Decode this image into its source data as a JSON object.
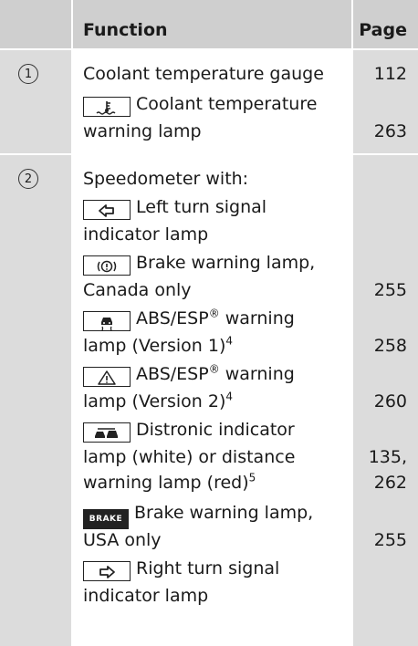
{
  "header": {
    "function_label": "Function",
    "page_label": "Page"
  },
  "rows": [
    {
      "number": "1",
      "items": [
        {
          "text": "Coolant temperature gauge",
          "page": "112"
        },
        {
          "icon": "coolant-temperature-icon",
          "line1": "Coolant temperature",
          "line2": "warning lamp",
          "page": "263"
        }
      ]
    },
    {
      "number": "2",
      "intro": "Speedometer with:",
      "items": [
        {
          "icon": "left-turn-signal-icon",
          "line1": "Left turn signal",
          "line2": "indicator lamp",
          "page": ""
        },
        {
          "icon": "brake-warning-icon",
          "line1": "Brake warning lamp,",
          "line2": "Canada only",
          "page": "255"
        },
        {
          "icon": "abs-esp-icon",
          "line1a": "ABS/ESP",
          "line1b": "®",
          "line1c": " warning",
          "line2a": "lamp (Version 1)",
          "line2b": "4",
          "page": "258"
        },
        {
          "icon": "warning-triangle-icon",
          "line1a": "ABS/ESP",
          "line1b": "®",
          "line1c": " warning",
          "line2a": "lamp (Version 2)",
          "line2b": "4",
          "page": "260"
        },
        {
          "icon": "distronic-icon",
          "line1": "Distronic indicator",
          "line2": "lamp (white) or distance",
          "line3a": "warning lamp (red)",
          "line3b": "5",
          "page_line1": "135,",
          "page_line2": "262"
        },
        {
          "icon": "brake-word-icon",
          "icon_text": "BRAKE",
          "line1": "Brake warning lamp,",
          "line2": "USA only",
          "page": "255"
        },
        {
          "icon": "right-turn-signal-icon",
          "line1": "Right turn signal",
          "line2": "indicator lamp",
          "page": ""
        }
      ]
    }
  ]
}
